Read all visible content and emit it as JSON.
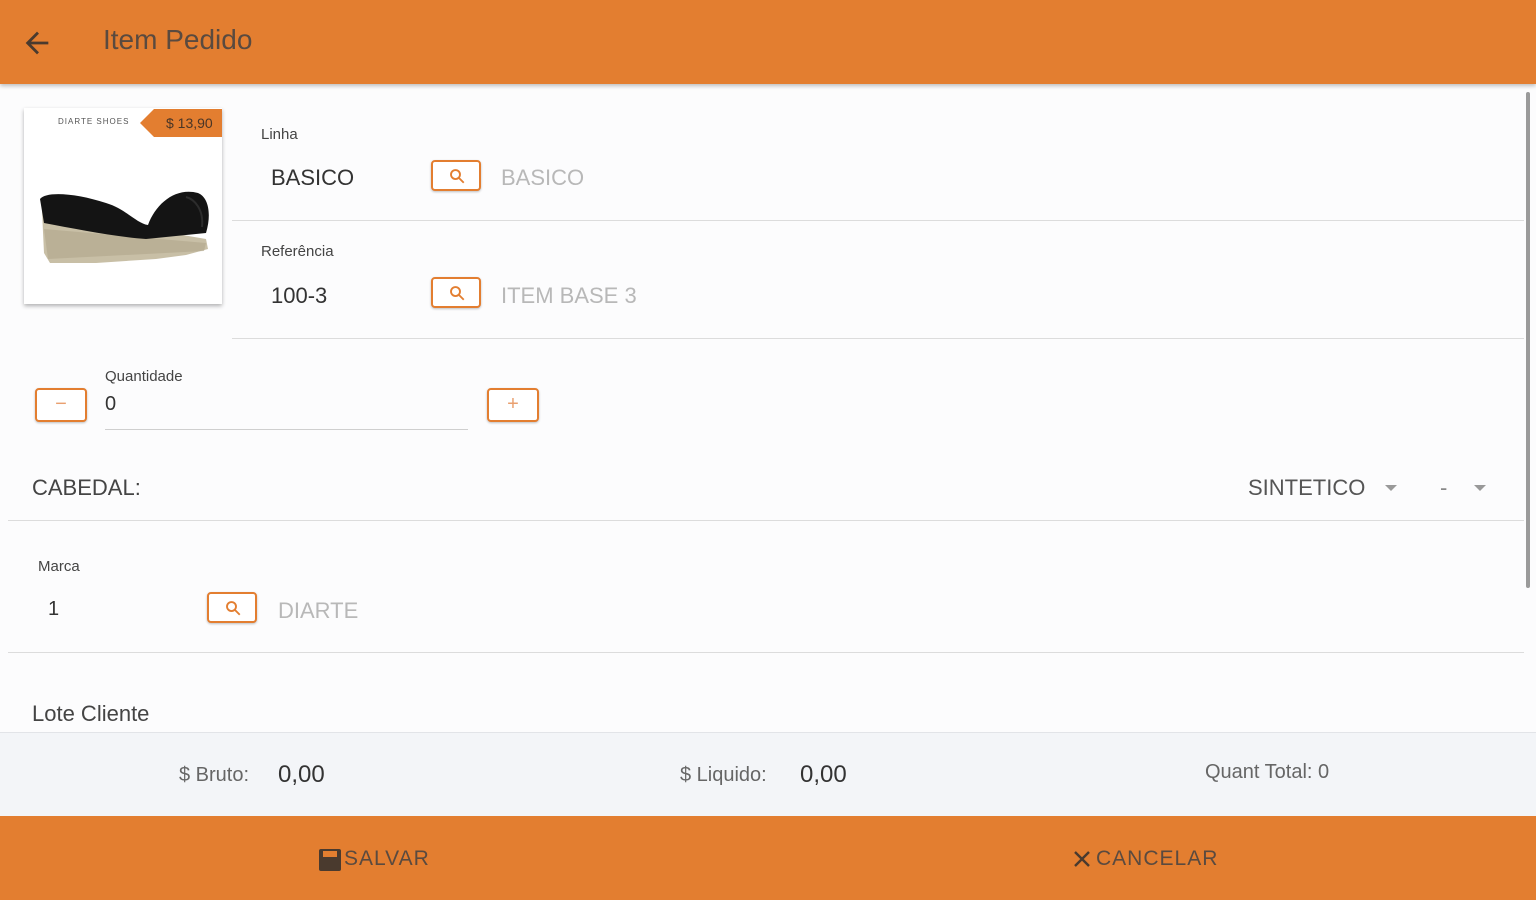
{
  "header": {
    "title": "Item Pedido"
  },
  "product": {
    "brand_text": "DIARTE SHOES",
    "price": "$ 13,90"
  },
  "linha": {
    "label": "Linha",
    "code": "BASICO",
    "description": "BASICO"
  },
  "referencia": {
    "label": "Referência",
    "code": "100-3",
    "description": "ITEM BASE 3"
  },
  "quantidade": {
    "label": "Quantidade",
    "value": "0",
    "minus": "−",
    "plus": "+"
  },
  "cabedal": {
    "label": "CABEDAL:",
    "select1": "SINTETICO",
    "select2": "-"
  },
  "marca": {
    "label": "Marca",
    "code": "1",
    "description": "DIARTE"
  },
  "lote": {
    "label": "Lote Cliente"
  },
  "totals": {
    "bruto_label": "$ Bruto:",
    "bruto_value": "0,00",
    "liquido_label": "$ Liquido:",
    "liquido_value": "0,00",
    "quant_total": "Quant Total: 0"
  },
  "actions": {
    "save": "SALVAR",
    "cancel": "CANCELAR"
  },
  "colors": {
    "accent": "#e37e30",
    "background": "#fcfcfd",
    "totals_bg": "#f3f5f8"
  }
}
